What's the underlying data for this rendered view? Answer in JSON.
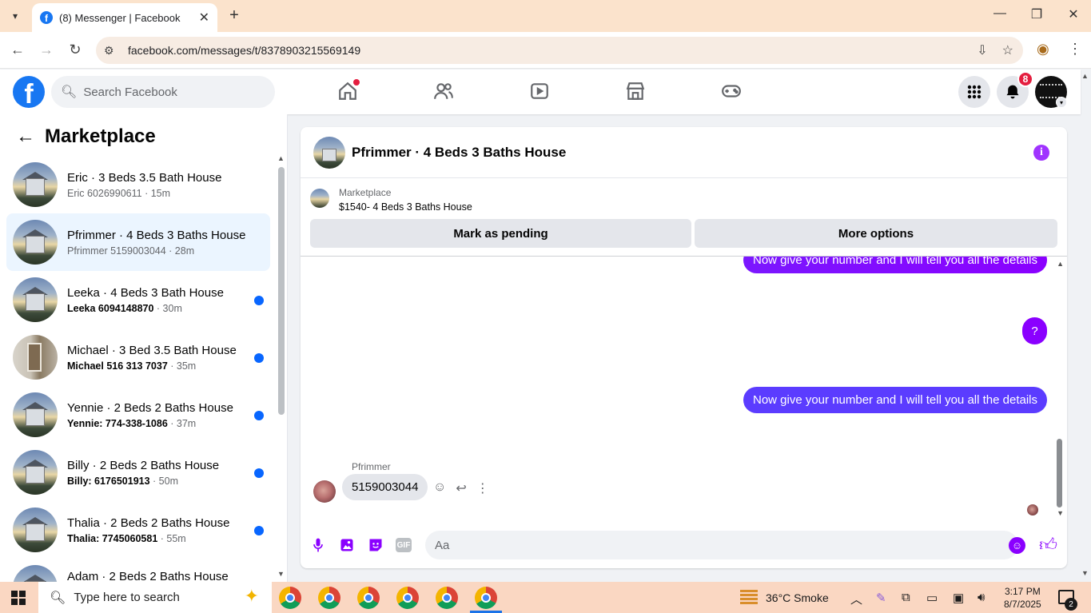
{
  "browser": {
    "tab_title": "(8) Messenger | Facebook",
    "url": "facebook.com/messages/t/8378903215569149"
  },
  "fb_header": {
    "search_placeholder": "Search Facebook",
    "notification_count": "8",
    "logo_letter": "f"
  },
  "sidebar": {
    "title": "Marketplace",
    "conversations": [
      {
        "name": "Eric · 3 Beds 3.5 Bath House",
        "who": "Eric 6026990611",
        "time": " · 15m",
        "unread": false,
        "selected": false
      },
      {
        "name": "Pfrimmer · 4 Beds 3 Baths House",
        "who": "Pfrimmer 5159003044",
        "time": " · 28m",
        "unread": false,
        "selected": true
      },
      {
        "name": "Leeka · 4 Beds 3 Bath House",
        "who": "Leeka 6094148870",
        "time": " · 30m",
        "unread": true,
        "selected": false
      },
      {
        "name": "Michael · 3 Bed 3.5 Bath House",
        "who": "Michael 516 313 7037",
        "time": " · 35m",
        "unread": true,
        "selected": false
      },
      {
        "name": "Yennie · 2 Beds 2 Baths House",
        "who": "Yennie: 774-338-1086",
        "time": " · 37m",
        "unread": true,
        "selected": false
      },
      {
        "name": "Billy · 2 Beds 2 Baths House",
        "who": "Billy: 6176501913",
        "time": " · 50m",
        "unread": true,
        "selected": false
      },
      {
        "name": "Thalia · 2 Beds 2 Baths House",
        "who": "Thalia: 7745060581",
        "time": " · 55m",
        "unread": true,
        "selected": false
      },
      {
        "name": "Adam · 2 Beds 2 Baths House",
        "who": "",
        "time": "",
        "unread": false,
        "selected": false
      }
    ]
  },
  "chat": {
    "title": "Pfrimmer · 4 Beds 3 Baths House",
    "marketplace_label": "Marketplace",
    "listing": "$1540- 4 Beds 3 Baths House",
    "mark_pending_label": "Mark as pending",
    "more_options_label": "More options",
    "messages_out": [
      "Now give your number and I will tell you all the details",
      "?",
      "Now give your number and I will tell you all the details"
    ],
    "sender_name": "Pfrimmer",
    "message_in": "5159003044",
    "composer_placeholder": "Aa",
    "info_glyph": "i",
    "gif_label": "GIF"
  },
  "taskbar": {
    "search_placeholder": "Type here to search",
    "weather": "36°C  Smoke",
    "time": "3:17 PM",
    "date": "8/7/2025",
    "notification_count": "2"
  },
  "colors": {
    "accent_purple": "#8a00ff",
    "fb_blue": "#1877f2",
    "unread_dot": "#0866ff"
  }
}
